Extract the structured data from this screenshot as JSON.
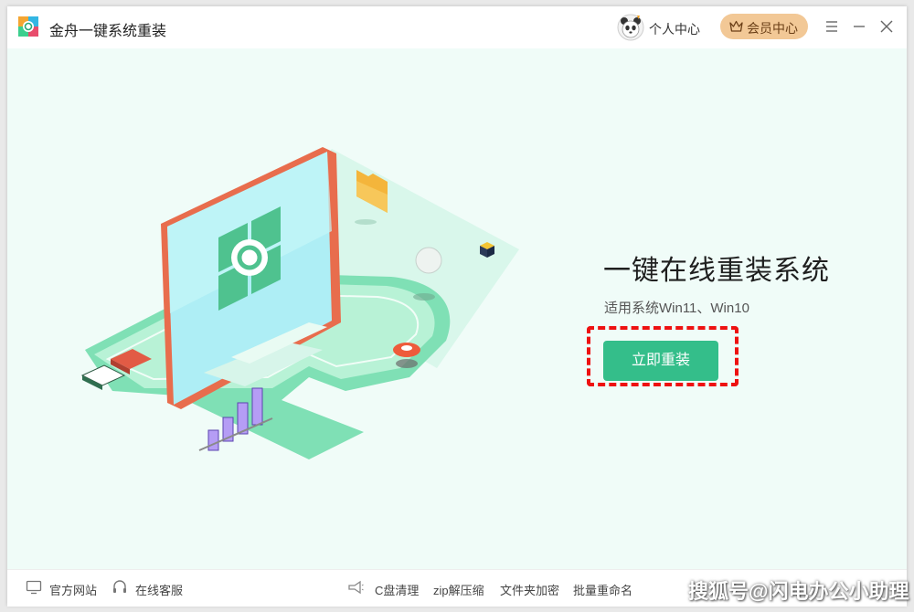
{
  "app": {
    "title": "金舟一键系统重装"
  },
  "header": {
    "profile_label": "个人中心",
    "member_label": "会员中心"
  },
  "main": {
    "headline": "一键在线重装系统",
    "subline": "适用系统Win11、Win10",
    "install_button": "立即重装"
  },
  "footer": {
    "official_site": "官方网站",
    "online_support": "在线客服",
    "c_clean": "C盘清理",
    "zip": "zip解压缩",
    "folder_encrypt": "文件夹加密",
    "batch_rename": "批量重命名"
  },
  "watermark": "搜狐号@闪电办公小助理",
  "colors": {
    "accent": "#34be8a",
    "member_bg": "#f2c896",
    "highlight_border": "#ee1111",
    "main_bg": "#f0fcf8"
  },
  "icons": [
    "app-logo-icon",
    "panda-avatar-icon",
    "crown-icon",
    "menu-icon",
    "minimize-icon",
    "close-icon",
    "monitor-icon",
    "headset-icon",
    "megaphone-icon"
  ]
}
